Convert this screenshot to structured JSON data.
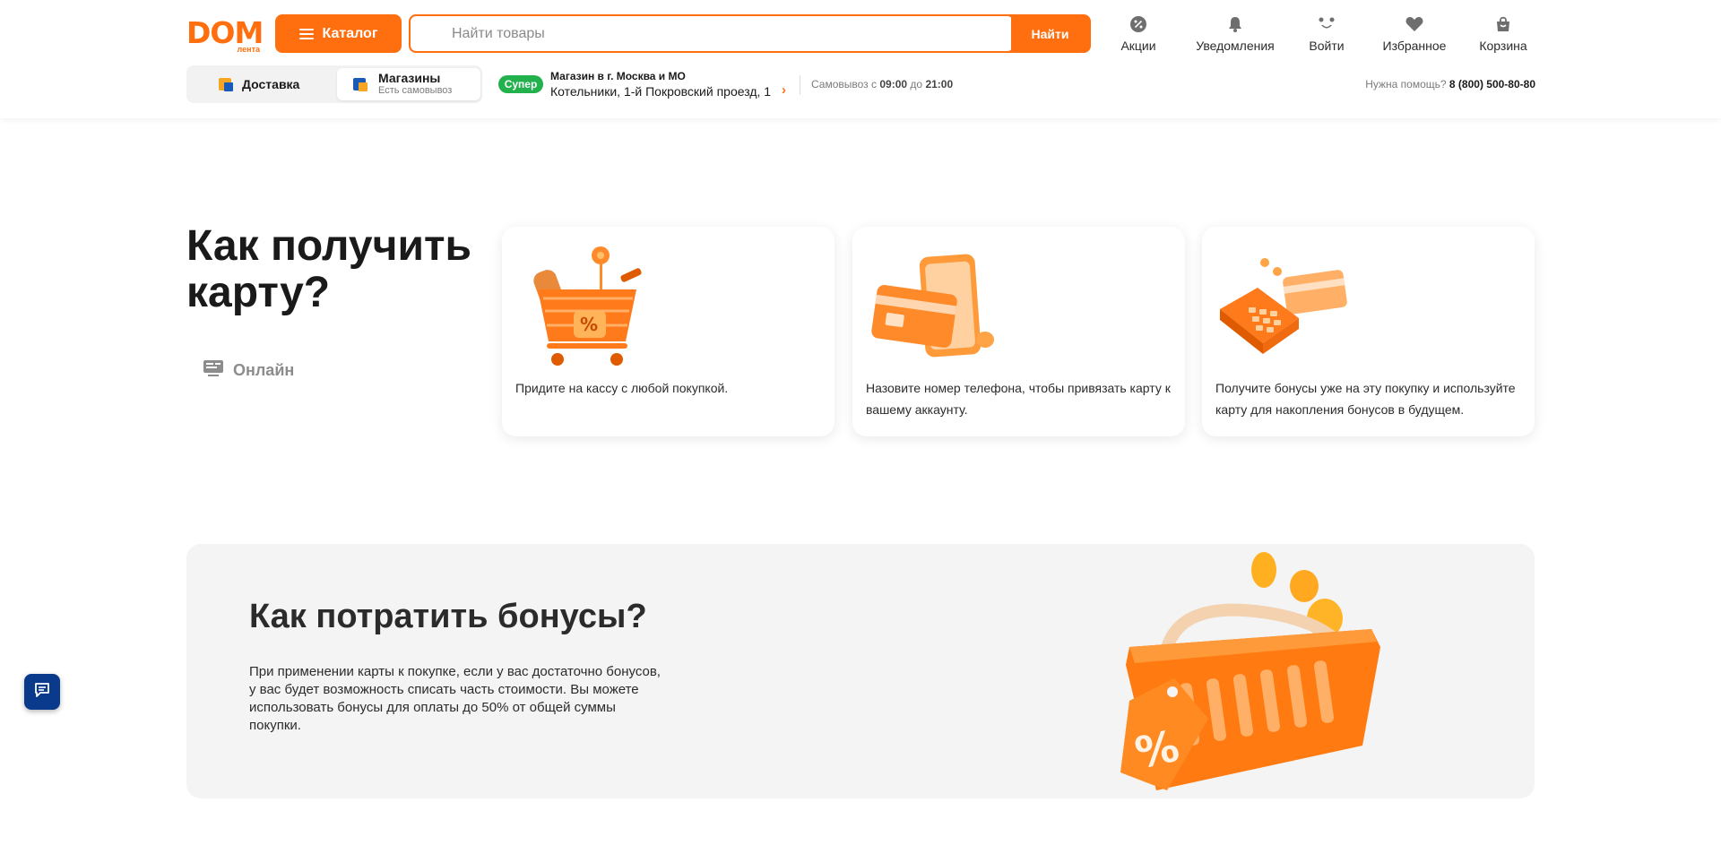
{
  "header": {
    "logo_text": "DOM",
    "logo_sub": "лента",
    "catalog_label": "Каталог",
    "search_placeholder": "Найти товары",
    "search_button": "Найти",
    "nav": [
      {
        "label": "Акции",
        "icon": "percent-icon"
      },
      {
        "label": "Уведомления",
        "icon": "bell-icon"
      },
      {
        "label": "Войти",
        "icon": "smile-icon"
      },
      {
        "label": "Избранное",
        "icon": "heart-icon"
      },
      {
        "label": "Корзина",
        "icon": "bag-icon"
      }
    ]
  },
  "subbar": {
    "delivery_label": "Доставка",
    "stores_label": "Магазины",
    "stores_sub": "Есть самовывоз",
    "store_badge": "Супер",
    "store_city": "Магазин в г. Москва и МО",
    "store_address": "Котельники, 1-й Покровский проезд, 1",
    "pickup_prefix": "Самовывоз с",
    "pickup_from": "09:00",
    "pickup_mid": "до",
    "pickup_to": "21:00",
    "help_label": "Нужна помощь?",
    "help_phone": "8 (800) 500-80-80"
  },
  "how_to_get": {
    "title": "Как получить карту?",
    "online_tab": "Онлайн",
    "cards": [
      {
        "text": "Придите на кассу с любой покупкой."
      },
      {
        "text": "Назовите номер телефона, чтобы привязать карту к вашему аккаунту."
      },
      {
        "text": "Получите бонусы уже на эту покупку и используйте карту для накопления бонусов в будущем."
      }
    ]
  },
  "bonuses": {
    "title": "Как потратить бонусы?",
    "text": "При применении карты к покупке, если у вас достаточно бонусов, у вас будет возможность списать часть стоимости. Вы можете использовать бонусы для оплаты до 50% от общей суммы покупки."
  },
  "colors": {
    "accent": "#ff6f0f",
    "badge_green": "#22b14c",
    "chat_blue": "#0a3a8c"
  }
}
